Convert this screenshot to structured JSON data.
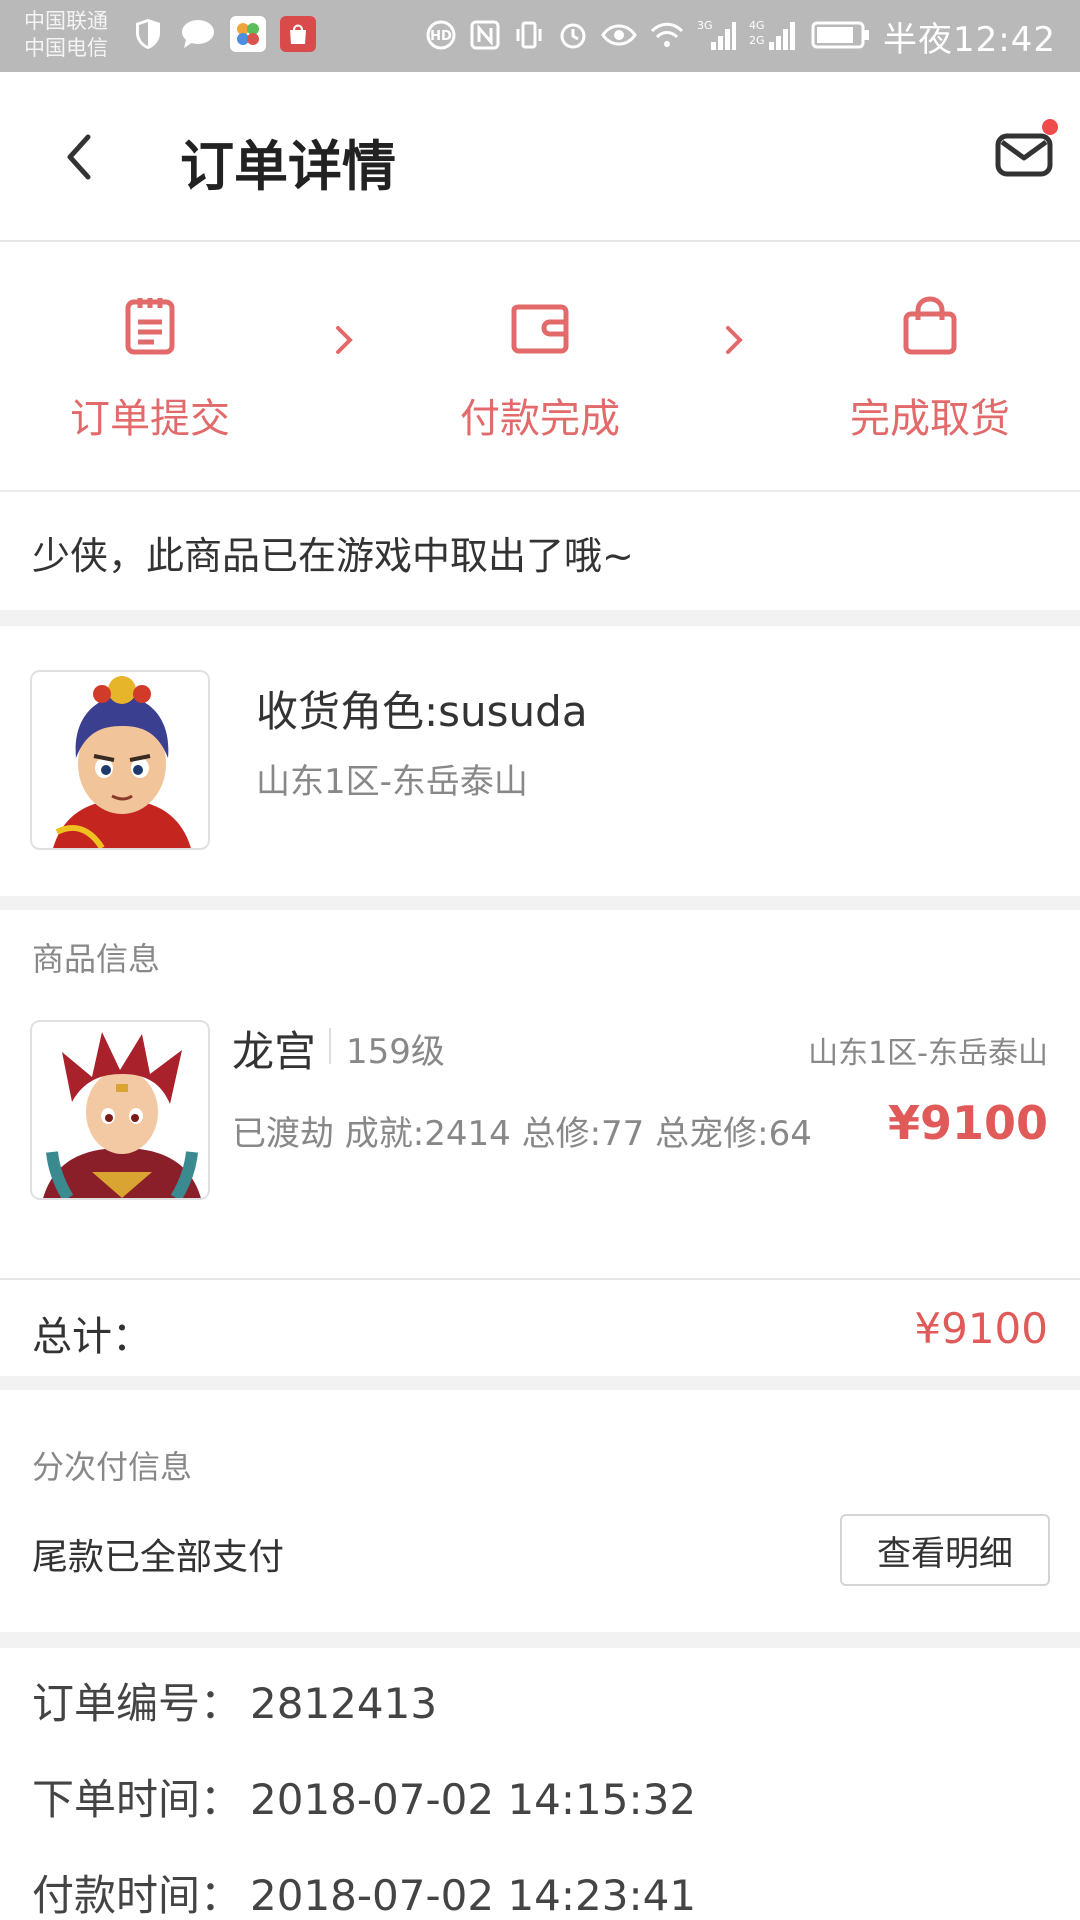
{
  "status_bar": {
    "carrier_1": "中国联通",
    "carrier_2": "中国电信",
    "time": "半夜12:42",
    "network_1": "3G",
    "network_2": "4G",
    "network_3": "2G"
  },
  "header": {
    "title": "订单详情"
  },
  "steps": [
    {
      "label": "订单提交",
      "icon": "clipboard-icon"
    },
    {
      "label": "付款完成",
      "icon": "wallet-icon"
    },
    {
      "label": "完成取货",
      "icon": "shopping-bag-icon"
    }
  ],
  "accent_color": "#e26a6a",
  "notice": "少侠，此商品已在游戏中取出了哦~",
  "receiver": {
    "name": "收货角色:susuda",
    "server": "山东1区-东岳泰山"
  },
  "goods": {
    "section_title": "商品信息",
    "name": "龙宫",
    "level": "159级",
    "server": "山东1区-东岳泰山",
    "stats": "已渡劫 成就:2414 总修:77 总宠修:64",
    "price": "¥9100"
  },
  "total": {
    "label": "总计：",
    "value": "¥9100"
  },
  "installment": {
    "section_title": "分次付信息",
    "status": "尾款已全部支付",
    "detail_button": "查看明细"
  },
  "order_info": {
    "order_no_label": "订单编号：",
    "order_no": "2812413",
    "order_time_label": "下单时间：",
    "order_time": "2018-07-02 14:15:32",
    "pay_time_label": "付款时间：",
    "pay_time": "2018-07-02 14:23:41"
  }
}
